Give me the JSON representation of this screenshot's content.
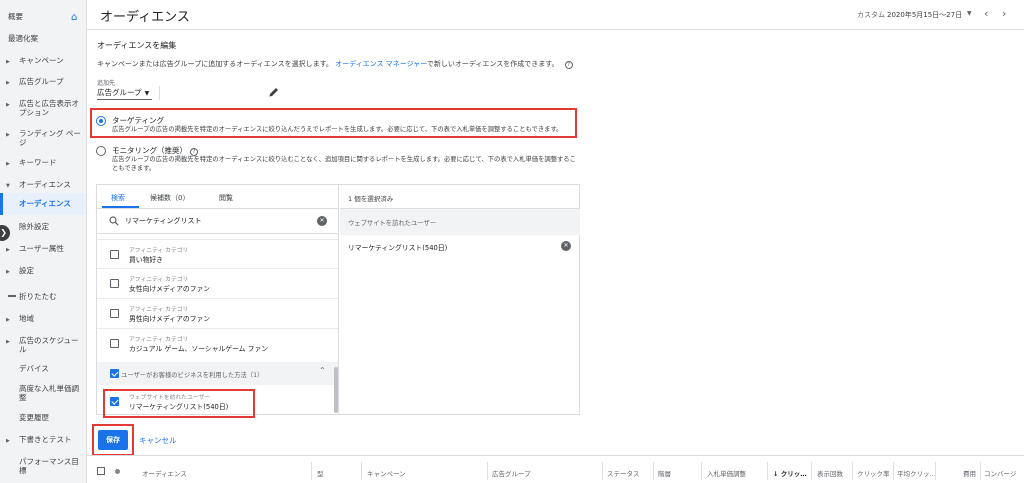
{
  "sidebar": {
    "items": [
      {
        "label": "概要"
      },
      {
        "label": "最適化案"
      },
      {
        "label": "キャンペーン"
      },
      {
        "label": "広告グループ"
      },
      {
        "label": "広告と広告表示オプション"
      },
      {
        "label": "ランディング ページ"
      },
      {
        "label": "キーワード"
      },
      {
        "label": "オーディエンス"
      },
      {
        "label": "オーディエンス"
      },
      {
        "label": "除外設定"
      },
      {
        "label": "ユーザー属性"
      },
      {
        "label": "設定"
      },
      {
        "label": "折りたたむ"
      },
      {
        "label": "地域"
      },
      {
        "label": "広告のスケジュール"
      },
      {
        "label": "デバイス"
      },
      {
        "label": "高度な入札単価調整"
      },
      {
        "label": "変更履歴"
      },
      {
        "label": "下書きとテスト"
      },
      {
        "label": "パフォーマンス目標"
      }
    ]
  },
  "header": {
    "title": "オーディエンス",
    "date_label": "カスタム",
    "date_range": "2020年5月15日〜27日"
  },
  "edit": {
    "section_title": "オーディエンスを編集",
    "description": "キャンペーンまたは広告グループに追加するオーディエンスを選択します。",
    "link_text": "オーディエンス マネージャー",
    "description_tail": "で新しいオーディエンスを作成できます。",
    "help_glyph": "?",
    "add_to_label": "追加先",
    "add_to_value": "広告グループ"
  },
  "options": {
    "targeting": {
      "title": "ターゲティング",
      "desc": "広告グループの広告の掲載先を特定のオーディエンスに絞り込んだうえでレポートを生成します。必要に応じて、下の表で入札単価を調整することもできます。",
      "selected": true
    },
    "monitoring": {
      "title": "モニタリング（推奨）",
      "desc": "広告グループの広告の掲載先を特定のオーディエンスに絞り込むことなく、追加項目に関するレポートを生成します。必要に応じて、下の表で入札単価を調整することもできます。",
      "selected": false
    }
  },
  "picker": {
    "tabs": {
      "search": "検索",
      "candidates": "候補数（0）",
      "browse": "閲覧"
    },
    "search_value": "リマーケティングリスト",
    "items": [
      {
        "category": "アフィニティ カテゴリ",
        "name": "買い物好き",
        "checked": false
      },
      {
        "category": "アフィニティ カテゴリ",
        "name": "女性向けメディアのファン",
        "checked": false
      },
      {
        "category": "アフィニティ カテゴリ",
        "name": "男性向けメディアのファン",
        "checked": false
      },
      {
        "category": "アフィニティ カテゴリ",
        "name": "カジュアル ゲーム、ソーシャルゲーム ファン",
        "checked": false
      }
    ],
    "group_label": "ユーザーがお客様のビジネスを利用した方法（1）",
    "selected_item": {
      "category": "ウェブサイトを訪れたユーザー",
      "name": "リマーケティングリスト(540日)",
      "checked": true
    }
  },
  "selected_panel": {
    "title": "1 個を選択済み",
    "group_label": "ウェブサイトを訪れたユーザー",
    "item": "リマーケティングリスト(540日)"
  },
  "actions": {
    "save": "保存",
    "cancel": "キャンセル"
  },
  "table": {
    "columns": [
      "オーディエンス",
      "型",
      "キャンペーン",
      "広告グループ",
      "ステータス",
      "階層",
      "入札単価調整",
      "↓ クリッ…",
      "表示回数",
      "クリック率",
      "平均クリッ…",
      "費用",
      "コンバージ"
    ]
  },
  "colors": {
    "accent": "#1a73e8",
    "highlight": "#e53935"
  }
}
